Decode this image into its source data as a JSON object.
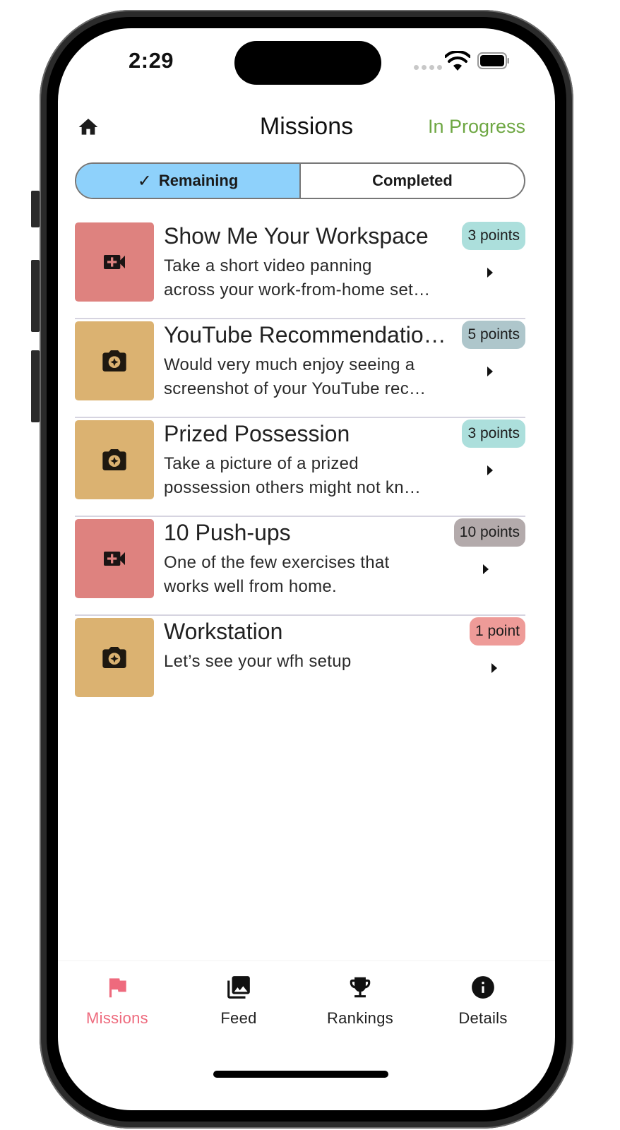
{
  "status_bar": {
    "time": "2:29"
  },
  "header": {
    "title": "Missions",
    "status_link": "In Progress",
    "status_color": "#6ea743"
  },
  "segmented": {
    "options": [
      {
        "label": "Remaining",
        "selected": true,
        "check": "✓"
      },
      {
        "label": "Completed",
        "selected": false
      }
    ],
    "active_color": "#8ed1fb"
  },
  "missions": [
    {
      "title": "Show Me Your Workspace",
      "desc_line1": "Take a short video panning",
      "desc_line2": "across your work-from-home set…",
      "points": "3 points",
      "type": "video",
      "icon": "video-add-icon",
      "thumb_color": "#de827f",
      "badge_color": "#acdfdc"
    },
    {
      "title": "YouTube Recommendatio…",
      "desc_line1": "Would very much enjoy seeing a",
      "desc_line2": "screenshot of your YouTube rec…",
      "points": "5 points",
      "type": "photo",
      "icon": "camera-icon",
      "thumb_color": "#dbb271",
      "badge_color": "#aec6cb"
    },
    {
      "title": "Prized Possession",
      "desc_line1": "Take a picture of a prized",
      "desc_line2": "possession others might not kn…",
      "points": "3 points",
      "type": "photo",
      "icon": "camera-icon",
      "thumb_color": "#dbb271",
      "badge_color": "#acdfdc"
    },
    {
      "title": "10 Push-ups",
      "desc_line1": "One of the few exercises that",
      "desc_line2": "works well from home.",
      "points": "10 points",
      "type": "video",
      "icon": "video-add-icon",
      "thumb_color": "#de827f",
      "badge_color": "#b3aaab"
    },
    {
      "title": "Workstation",
      "desc_line1": "Let’s see your wfh setup",
      "desc_line2": "",
      "points": "1 point",
      "type": "photo",
      "icon": "camera-icon",
      "thumb_color": "#dbb271",
      "badge_color": "#ee9b98"
    }
  ],
  "bottom_nav": {
    "items": [
      {
        "label": "Missions",
        "icon": "flag-icon",
        "active": true
      },
      {
        "label": "Feed",
        "icon": "photo-library-icon",
        "active": false
      },
      {
        "label": "Rankings",
        "icon": "trophy-icon",
        "active": false
      },
      {
        "label": "Details",
        "icon": "info-icon",
        "active": false
      }
    ],
    "active_color": "#ee6a7d"
  }
}
